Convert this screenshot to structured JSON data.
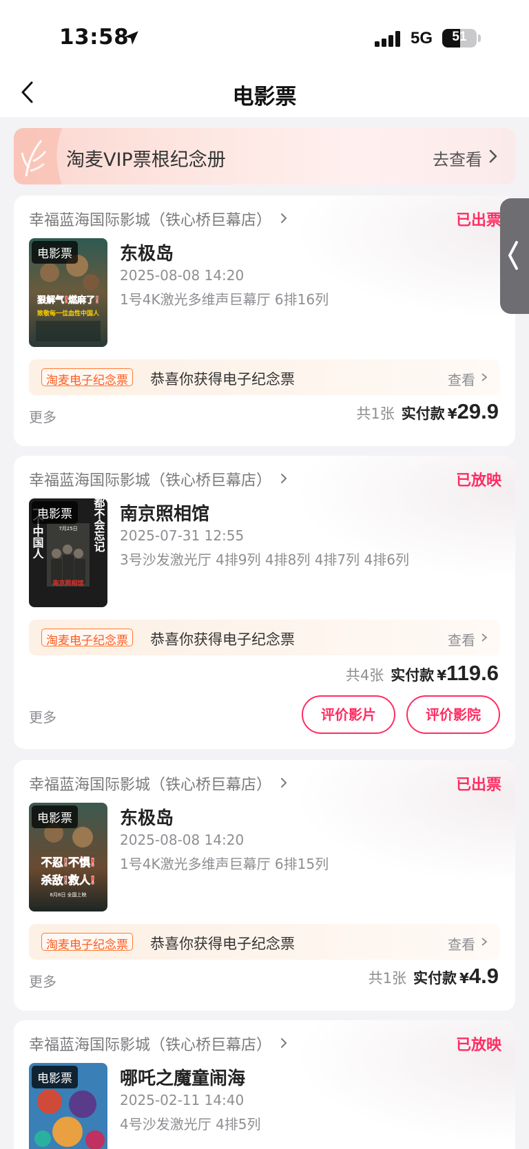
{
  "status_bar": {
    "time": "13:58",
    "network": "5G",
    "battery": "51"
  },
  "nav": {
    "title": "电影票"
  },
  "banner": {
    "title": "淘麦VIP票根纪念册",
    "link": "去查看"
  },
  "orders": [
    {
      "cinema": "幸福蓝海国际影城（铁心桥巨幕店）",
      "status": "已出票",
      "status_color": "#ff2c62",
      "poster_tag": "电影票",
      "movie": "东极岛",
      "showtime": "2025-08-08 14:20",
      "seats": "1号4K激光多维声巨幕厅 6排16列",
      "souvenir_badge": "淘麦电子纪念票",
      "souvenir_text": "恭喜你获得电子纪念票",
      "souvenir_view": "查看",
      "more": "更多",
      "count": "共1张",
      "paid_label": "实付款",
      "currency": "¥",
      "amount": "29.9"
    },
    {
      "cinema": "幸福蓝海国际影城（铁心桥巨幕店）",
      "status": "已放映",
      "status_color": "#ff2c62",
      "poster_tag": "电影票",
      "movie": "南京照相馆",
      "showtime": "2025-07-31 12:55",
      "seats": "3号沙发激光厅 4排9列 4排8列 4排7列 4排6列",
      "souvenir_badge": "淘麦电子纪念票",
      "souvenir_text": "恭喜你获得电子纪念票",
      "souvenir_view": "查看",
      "more": "更多",
      "count": "共4张",
      "paid_label": "实付款",
      "currency": "¥",
      "amount": "119.6",
      "buttons": [
        "评价影片",
        "评价影院"
      ]
    },
    {
      "cinema": "幸福蓝海国际影城（铁心桥巨幕店）",
      "status": "已出票",
      "status_color": "#ff2c62",
      "poster_tag": "电影票",
      "movie": "东极岛",
      "showtime": "2025-08-08 14:20",
      "seats": "1号4K激光多维声巨幕厅 6排15列",
      "souvenir_badge": "淘麦电子纪念票",
      "souvenir_text": "恭喜你获得电子纪念票",
      "souvenir_view": "查看",
      "more": "更多",
      "count": "共1张",
      "paid_label": "实付款",
      "currency": "¥",
      "amount": "4.9"
    },
    {
      "cinema": "幸福蓝海国际影城（铁心桥巨幕店）",
      "status": "已放映",
      "status_color": "#ff2c62",
      "poster_tag": "电影票",
      "movie": "哪吒之魔童闹海",
      "showtime": "2025-02-11 14:40",
      "seats": "4号沙发激光厅 4排5列"
    }
  ],
  "posters": {
    "p1": {
      "text1": "狠解气!燃麻了!",
      "text2": "致敬每一位血性中国人"
    },
    "p2": {
      "text_right": "都不会忘记",
      "text_left": "一个中国人",
      "text_mid": "南京照相馆",
      "date": "7月25日"
    },
    "p3": {
      "text1": "不忍!不惧!",
      "text2": "杀敌!救人!",
      "text3": "8月8日 全国上映"
    }
  }
}
